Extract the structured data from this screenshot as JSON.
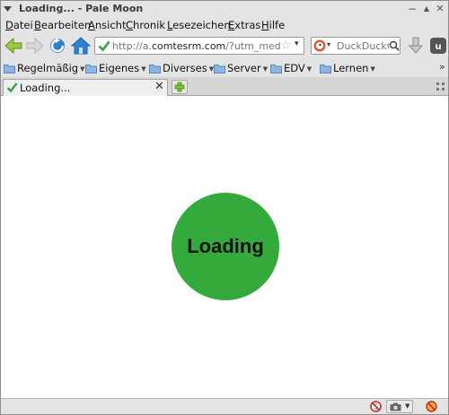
{
  "window": {
    "title": "Loading... - Pale Moon",
    "controls": {
      "minimize": "−",
      "maximize": "▲",
      "close": "✕"
    }
  },
  "menu": [
    {
      "label": "Datei",
      "accel": "D",
      "rest": "atei"
    },
    {
      "label": "Bearbeiten",
      "accel": "B",
      "rest": "earbeiten"
    },
    {
      "label": "Ansicht",
      "accel": "A",
      "rest": "nsicht"
    },
    {
      "label": "Chronik",
      "accel": "C",
      "rest": "hronik"
    },
    {
      "label": "Lesezeichen",
      "accel": "L",
      "rest": "esezeichen"
    },
    {
      "label": "Extras",
      "accel": "E",
      "rest": "xtras"
    },
    {
      "label": "Hilfe",
      "accel": "H",
      "rest": "ilfe"
    }
  ],
  "navbar": {
    "url_prefix": "http://a.",
    "url_domain": "comtesrm.com",
    "url_rest": "/?utm_medium=",
    "search_placeholder": "DuckDuckG",
    "dropdown_glyph": "▾",
    "star_glyph": "☆"
  },
  "bookmarks": [
    {
      "label": "Regelmäßig"
    },
    {
      "label": "Eigenes"
    },
    {
      "label": "Diverses"
    },
    {
      "label": "Server"
    },
    {
      "label": "EDV"
    },
    {
      "label": "Lernen"
    }
  ],
  "bookmarks_more": "»",
  "tab": {
    "label": "Loading...",
    "close": "✕"
  },
  "content": {
    "loader_text": "Loading"
  },
  "colors": {
    "accent_green": "#34aa3c",
    "chrome": "#e4e4e4"
  }
}
